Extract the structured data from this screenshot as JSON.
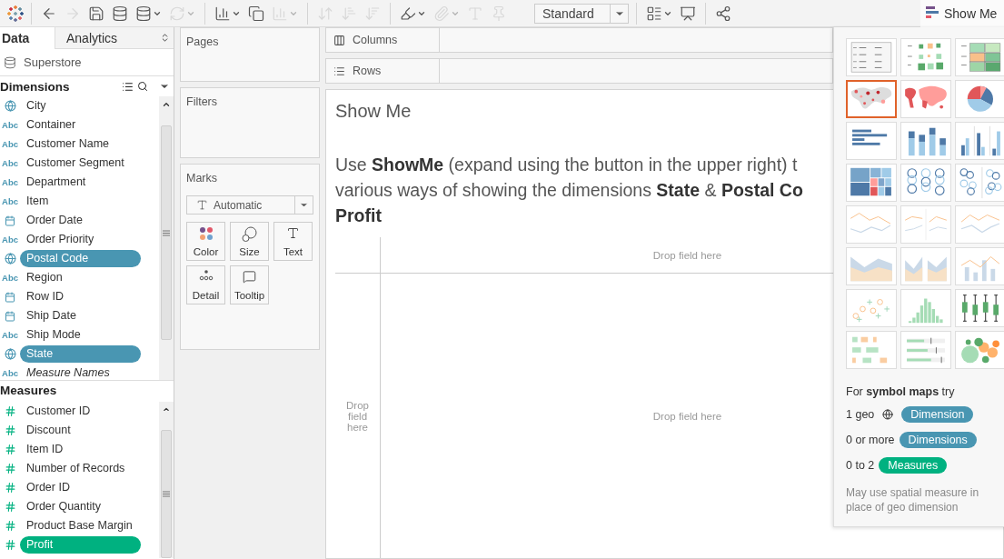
{
  "toolbar": {
    "groups": [
      [
        {
          "kind": "logo"
        }
      ],
      [
        {
          "kind": "back",
          "disabled": false,
          "menu": false
        },
        {
          "kind": "forward",
          "disabled": true,
          "menu": false
        },
        {
          "kind": "save",
          "disabled": false,
          "menu": false
        },
        {
          "kind": "new_data_source",
          "disabled": false,
          "menu": false
        },
        {
          "kind": "pause",
          "disabled": false,
          "menu": true
        },
        {
          "kind": "refresh",
          "disabled": true,
          "menu": true
        }
      ],
      [
        {
          "kind": "new_sheet",
          "disabled": false,
          "menu": true
        },
        {
          "kind": "duplicate",
          "disabled": false,
          "menu": false
        },
        {
          "kind": "clear",
          "disabled": true,
          "menu": true
        }
      ],
      [
        {
          "kind": "swap",
          "disabled": true,
          "menu": false
        },
        {
          "kind": "sort_ascending",
          "disabled": true,
          "menu": false
        },
        {
          "kind": "sort_descending",
          "disabled": true,
          "menu": false
        }
      ],
      [
        {
          "kind": "highlight",
          "disabled": false,
          "menu": true
        },
        {
          "kind": "attach",
          "disabled": true,
          "menu": true
        },
        {
          "kind": "label",
          "disabled": true,
          "menu": false
        },
        {
          "kind": "pin",
          "disabled": true,
          "menu": false
        },
        {
          "kind": "fit",
          "value": "Standard"
        }
      ],
      [
        {
          "kind": "cards",
          "disabled": false,
          "menu": true
        },
        {
          "kind": "presentation",
          "disabled": false,
          "menu": false
        }
      ],
      [
        {
          "kind": "share",
          "disabled": false,
          "menu": false
        }
      ]
    ],
    "show_me_button": {
      "label": "Show Me",
      "expanded": true
    }
  },
  "data_pane": {
    "tabs": [
      {
        "label": "Data",
        "selected": true
      },
      {
        "label": "Analytics",
        "selected": false
      }
    ],
    "data_source": "Superstore",
    "dimensions": {
      "title": "Dimensions",
      "fields": [
        {
          "kind": "geo",
          "label": "City",
          "selected": false,
          "italic": false
        },
        {
          "kind": "string",
          "badge": "Abc",
          "label": "Container",
          "selected": false,
          "italic": false
        },
        {
          "kind": "string",
          "badge": "Abc",
          "label": "Customer Name",
          "selected": false,
          "italic": false
        },
        {
          "kind": "string",
          "badge": "Abc",
          "label": "Customer Segment",
          "selected": false,
          "italic": false
        },
        {
          "kind": "string",
          "badge": "Abc",
          "label": "Department",
          "selected": false,
          "italic": false
        },
        {
          "kind": "string",
          "badge": "Abc",
          "label": "Item",
          "selected": false,
          "italic": false
        },
        {
          "kind": "date",
          "label": "Order Date",
          "selected": false,
          "italic": false
        },
        {
          "kind": "string",
          "badge": "Abc",
          "label": "Order Priority",
          "selected": false,
          "italic": false
        },
        {
          "kind": "geo",
          "label": "Postal Code",
          "selected": true,
          "italic": false
        },
        {
          "kind": "string",
          "badge": "Abc",
          "label": "Region",
          "selected": false,
          "italic": false
        },
        {
          "kind": "date",
          "label": "Row ID",
          "selected": false,
          "italic": false
        },
        {
          "kind": "date",
          "label": "Ship Date",
          "selected": false,
          "italic": false
        },
        {
          "kind": "string",
          "badge": "Abc",
          "label": "Ship Mode",
          "selected": false,
          "italic": false
        },
        {
          "kind": "geo",
          "label": "State",
          "selected": true,
          "italic": false
        },
        {
          "kind": "string",
          "badge": "Abc",
          "label": "Measure Names",
          "selected": false,
          "italic": true
        }
      ]
    },
    "measures": {
      "title": "Measures",
      "fields": [
        {
          "kind": "number",
          "label": "Customer ID",
          "selected": false
        },
        {
          "kind": "number",
          "label": "Discount",
          "selected": false
        },
        {
          "kind": "number",
          "label": "Item ID",
          "selected": false
        },
        {
          "kind": "number",
          "label": "Number of Records",
          "selected": false
        },
        {
          "kind": "number",
          "label": "Order ID",
          "selected": false
        },
        {
          "kind": "number",
          "label": "Order Quantity",
          "selected": false
        },
        {
          "kind": "number",
          "label": "Product Base Margin",
          "selected": false
        },
        {
          "kind": "number",
          "label": "Profit",
          "selected": true
        }
      ]
    }
  },
  "pages": {
    "title": "Pages"
  },
  "filters": {
    "title": "Filters"
  },
  "marks": {
    "title": "Marks",
    "mark_type": "Automatic",
    "buttons": [
      {
        "kind": "color",
        "label": "Color"
      },
      {
        "kind": "size",
        "label": "Size"
      },
      {
        "kind": "text",
        "label": "Text"
      },
      {
        "kind": "detail",
        "label": "Detail"
      },
      {
        "kind": "tooltip",
        "label": "Tooltip"
      }
    ]
  },
  "shelves": [
    {
      "kind": "columns",
      "label": "Columns"
    },
    {
      "kind": "rows",
      "label": "Rows"
    }
  ],
  "sheet": {
    "title": "Show Me",
    "message_lines": [
      "Use **ShowMe** (expand using the button in the upper right) t",
      "various ways of showing the dimensions **State** & **Postal Co**",
      "**Profit**"
    ],
    "drop_columns": "Drop field here",
    "drop_rows": "Drop field here",
    "drop_body": "Drop field here"
  },
  "show_me": {
    "charts": [
      {
        "kind": "text_table",
        "selected": false
      },
      {
        "kind": "heat_map",
        "selected": false
      },
      {
        "kind": "highlight_table",
        "selected": false
      },
      {
        "kind": "symbol_map",
        "selected": true
      },
      {
        "kind": "filled_map",
        "selected": false
      },
      {
        "kind": "pie",
        "selected": false
      },
      {
        "kind": "horizontal_bars",
        "selected": false
      },
      {
        "kind": "stacked_bars",
        "selected": false
      },
      {
        "kind": "side_by_side_bars",
        "selected": false
      },
      {
        "kind": "treemap",
        "selected": false
      },
      {
        "kind": "circle_view",
        "selected": false
      },
      {
        "kind": "side_by_side_circles",
        "selected": false
      },
      {
        "kind": "continuous_lines",
        "selected": false
      },
      {
        "kind": "discrete_lines",
        "selected": false
      },
      {
        "kind": "dual_lines",
        "selected": false
      },
      {
        "kind": "continuous_area",
        "selected": false
      },
      {
        "kind": "discrete_area",
        "selected": false
      },
      {
        "kind": "dual_combination",
        "selected": false
      },
      {
        "kind": "scatter",
        "selected": false
      },
      {
        "kind": "histogram",
        "selected": false
      },
      {
        "kind": "box_whisker",
        "selected": false
      },
      {
        "kind": "gantt",
        "selected": false
      },
      {
        "kind": "bullet",
        "selected": false
      },
      {
        "kind": "packed_bubbles",
        "selected": false
      }
    ],
    "hint": {
      "title": "For **symbol maps** try",
      "requirements": [
        {
          "count": "1 geo",
          "geo_icon": true,
          "pill": {
            "label": "Dimension",
            "kind": "dimension"
          }
        },
        {
          "count": "0 or more",
          "geo_icon": false,
          "pill": {
            "label": "Dimensions",
            "kind": "dimension"
          }
        },
        {
          "count": "0 to 2",
          "geo_icon": false,
          "pill": {
            "label": "Measures",
            "kind": "measure"
          }
        }
      ],
      "note": "May use spatial measure in place of geo dimension"
    }
  }
}
